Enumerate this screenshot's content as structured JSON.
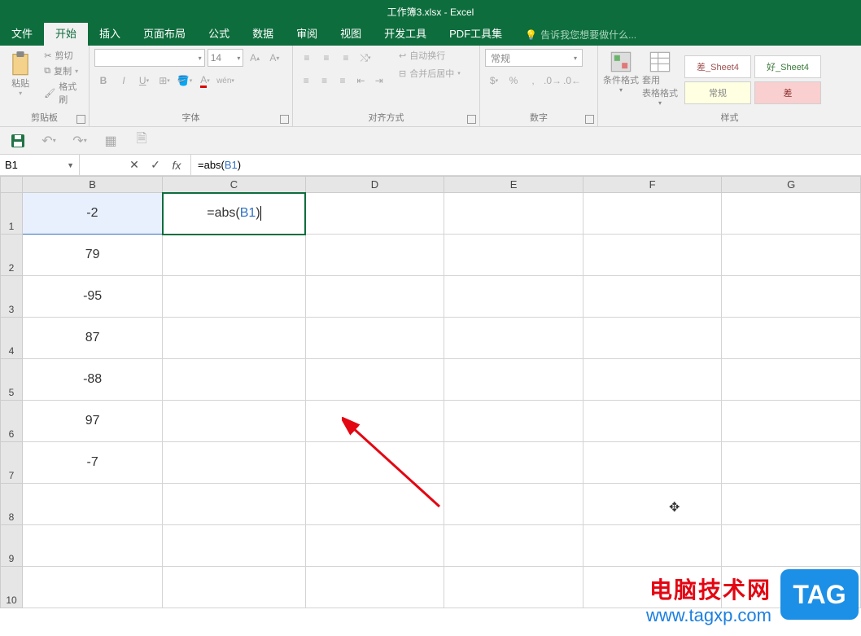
{
  "app": {
    "title": "工作簿3.xlsx - Excel"
  },
  "tabs": {
    "t0": "文件",
    "t1": "开始",
    "t2": "插入",
    "t3": "页面布局",
    "t4": "公式",
    "t5": "数据",
    "t6": "审阅",
    "t7": "视图",
    "t8": "开发工具",
    "t9": "PDF工具集",
    "tell_me": "告诉我您想要做什么..."
  },
  "ribbon": {
    "clipboard": {
      "paste": "粘贴",
      "cut": "剪切",
      "copy": "复制",
      "painter": "格式刷",
      "label": "剪贴板"
    },
    "font": {
      "size": "14",
      "label": "字体"
    },
    "align": {
      "wrap": "自动换行",
      "merge": "合并后居中",
      "label": "对齐方式"
    },
    "number": {
      "format": "常规",
      "label": "数字"
    },
    "styles": {
      "cond": "条件格式",
      "tbl": "套用\n表格格式",
      "s1": "差_Sheet4",
      "s2": "好_Sheet4",
      "s3": "常规",
      "s4": "差",
      "label": "样式"
    }
  },
  "formula_bar": {
    "name_box": "B1",
    "formula_prefix": "=abs(",
    "formula_ref": "B1",
    "formula_suffix": ")"
  },
  "columns": {
    "c0": "B",
    "c1": "C",
    "c2": "D",
    "c3": "E",
    "c4": "F",
    "c5": "G"
  },
  "rows": {
    "r1": "1",
    "r2": "2",
    "r3": "3",
    "r4": "4",
    "r5": "5",
    "r6": "6",
    "r7": "7",
    "r8": "8",
    "r9": "9",
    "r10": "10"
  },
  "cells": {
    "B1": "-2",
    "B2": "79",
    "B3": "-95",
    "B4": "87",
    "B5": "-88",
    "B6": "97",
    "B7": "-7",
    "C1_prefix": "=abs(",
    "C1_ref": "B1",
    "C1_suffix": ")"
  },
  "watermark": {
    "line1": "电脑技术网",
    "line2": "www.tagxp.com",
    "badge": "TAG"
  }
}
